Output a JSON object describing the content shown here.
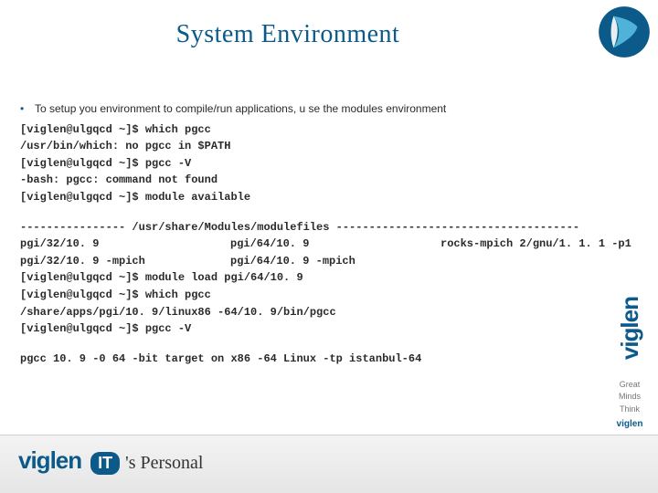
{
  "title": "System Environment",
  "bullet": "To setup you environment to compile/run applications, u se the modules environment",
  "term1": "[viglen@ulgqcd ~]$ which pgcc\n/usr/bin/which: no pgcc in $PATH\n[viglen@ulgqcd ~]$ pgcc -V\n-bash: pgcc: command not found\n[viglen@ulgqcd ~]$ module available",
  "divider": "---------------- /usr/share/Modules/modulefiles -------------------------------------",
  "cols": {
    "c1": [
      "pgi/32/10. 9",
      "pgi/32/10. 9 -mpich"
    ],
    "c2": [
      "pgi/64/10. 9",
      "pgi/64/10. 9 -mpich"
    ],
    "c3": [
      "rocks-mpich 2/gnu/1. 1. 1 -p1"
    ]
  },
  "term2": "[viglen@ulgqcd ~]$ module load pgi/64/10. 9\n[viglen@ulgqcd ~]$ which pgcc\n/share/apps/pgi/10. 9/linux86 -64/10. 9/bin/pgcc\n[viglen@ulgqcd ~]$ pgcc -V",
  "term3": "pgcc 10. 9 -0 64 -bit target on x86 -64 Linux -tp istanbul-64",
  "footer": {
    "brand": "viglen",
    "pill": "IT",
    "personal": "'s Personal"
  },
  "side": {
    "brand": "viglen",
    "t1": "Great",
    "t2": "Minds",
    "t3": "Think",
    "mini": "viglen"
  }
}
